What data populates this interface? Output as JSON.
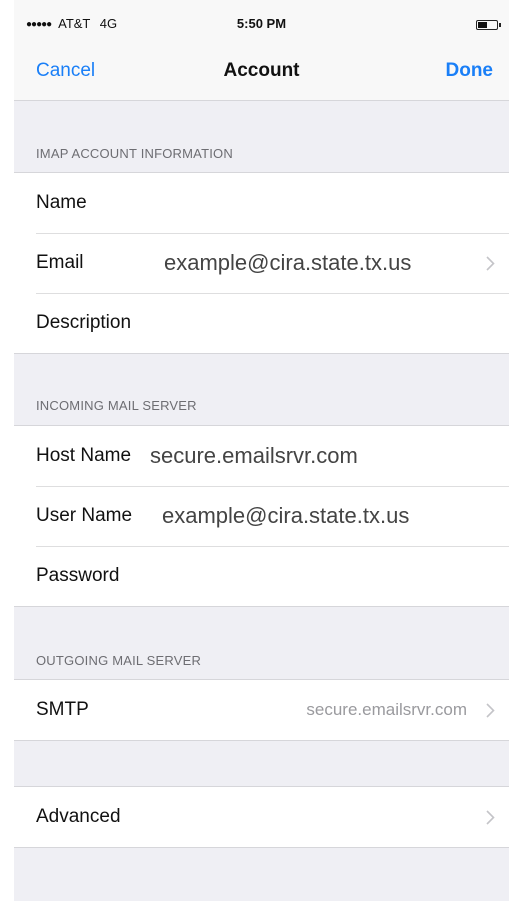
{
  "status_bar": {
    "signal": "●●●●●",
    "carrier": "AT&T",
    "network": "4G",
    "time": "5:50 PM",
    "battery_icon": "battery-low-icon"
  },
  "nav": {
    "cancel_label": "Cancel",
    "title": "Account",
    "done_label": "Done"
  },
  "imap": {
    "header": "IMAP ACCOUNT INFORMATION",
    "name_label": "Name",
    "email_label": "Email",
    "email_value": "example@cira.state.tx.us",
    "description_label": "Description"
  },
  "incoming": {
    "header": "INCOMING MAIL SERVER",
    "host_label": "Host Name",
    "host_value": "secure.emailsrvr.com",
    "user_label": "User Name",
    "user_value": "example@cira.state.tx.us",
    "password_label": "Password"
  },
  "outgoing": {
    "header": "OUTGOING MAIL SERVER",
    "smtp_label": "SMTP",
    "smtp_value": "secure.emailsrvr.com"
  },
  "advanced": {
    "label": "Advanced"
  },
  "colors": {
    "accent": "#1a7ff7",
    "background": "#efeff4",
    "separator": "#d6d6da"
  }
}
